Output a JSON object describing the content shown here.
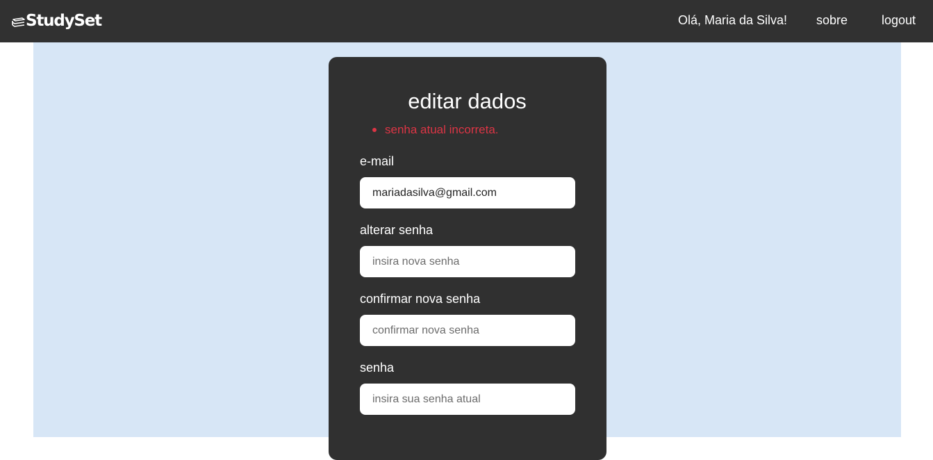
{
  "navbar": {
    "brand": "StudySet",
    "greeting": "Olá, Maria da Silva!",
    "about_label": "sobre",
    "logout_label": "logout"
  },
  "form": {
    "title": "editar dados",
    "errors": [
      "senha atual incorreta."
    ],
    "fields": {
      "email": {
        "label": "e-mail",
        "value": "mariadasilva@gmail.com",
        "placeholder": ""
      },
      "new_password": {
        "label": "alterar senha",
        "value": "",
        "placeholder": "insira nova senha"
      },
      "confirm_password": {
        "label": "confirmar nova senha",
        "value": "",
        "placeholder": "confirmar nova senha"
      },
      "current_password": {
        "label": "senha",
        "value": "",
        "placeholder": "insira sua senha atual"
      }
    }
  },
  "colors": {
    "navbar_bg": "#313131",
    "content_bg": "#d7e6f6",
    "card_bg": "#303030",
    "error": "#dc3545"
  },
  "icons": {
    "brand": "stacked-books-icon"
  }
}
